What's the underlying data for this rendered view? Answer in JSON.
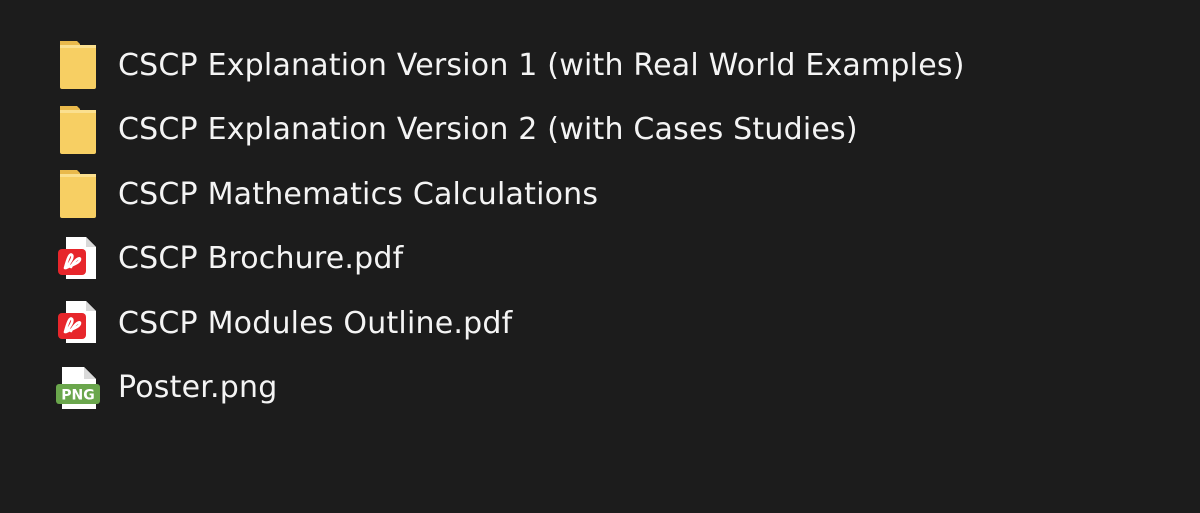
{
  "colors": {
    "background": "#1c1c1c",
    "text": "#f4f4f4",
    "folder": "#f7cf63",
    "pdf_red": "#e7262b",
    "png_green": "#6aa64c"
  },
  "files": [
    {
      "name": "CSCP Explanation Version 1 (with Real World Examples)",
      "type": "folder",
      "icon": "folder-icon"
    },
    {
      "name": "CSCP Explanation Version 2 (with Cases Studies)",
      "type": "folder",
      "icon": "folder-icon"
    },
    {
      "name": "CSCP Mathematics Calculations",
      "type": "folder",
      "icon": "folder-icon"
    },
    {
      "name": "CSCP Brochure.pdf",
      "type": "pdf",
      "icon": "pdf-file-icon"
    },
    {
      "name": "CSCP Modules Outline.pdf",
      "type": "pdf",
      "icon": "pdf-file-icon"
    },
    {
      "name": "Poster.png",
      "type": "png",
      "icon": "png-file-icon",
      "icon_text": "PNG"
    }
  ]
}
